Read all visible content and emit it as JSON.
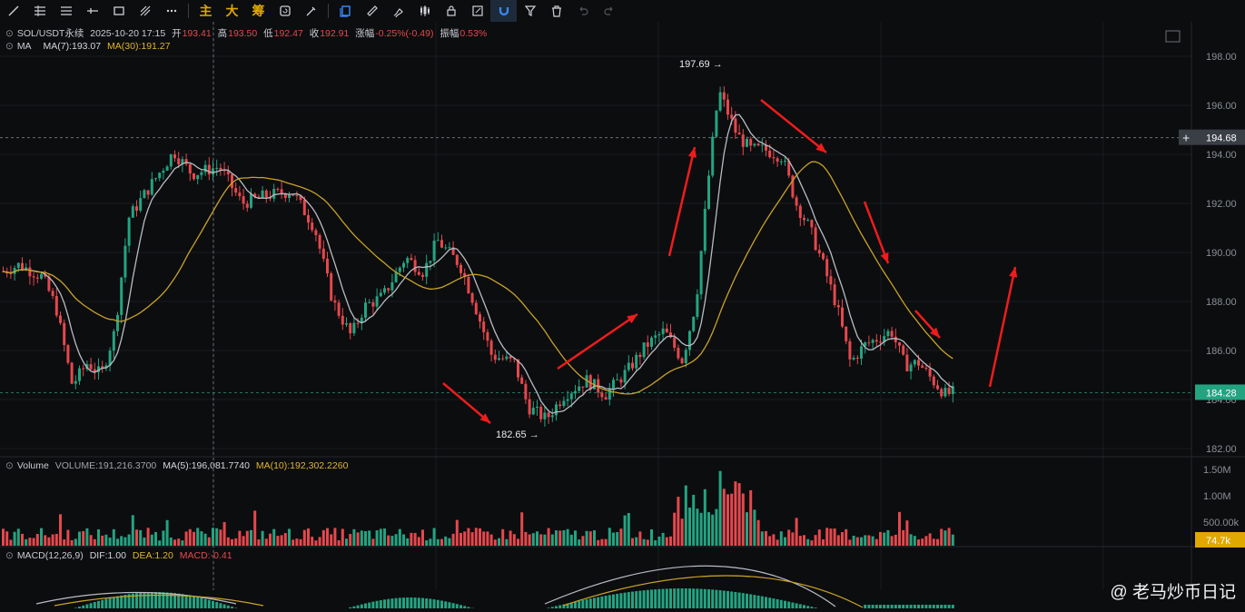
{
  "toolbar": {
    "main_label": "主",
    "big_label": "大",
    "chips_label": "筹"
  },
  "header": {
    "symbol": "SOL/USDT永续",
    "datetime": "2025-10-20 17:15",
    "open_label": "开",
    "open": "193.41",
    "high_label": "高",
    "high": "193.50",
    "low_label": "低",
    "low": "192.47",
    "close_label": "收",
    "close": "192.91",
    "change_label": "涨幅",
    "change": "-0.25%(-0.49)",
    "amplitude_label": "振幅",
    "amplitude": "0.53%"
  },
  "ma_line": {
    "label": "MA",
    "ma7": "MA(7):193.07",
    "ma30": "MA(30):191.27"
  },
  "volume_line": {
    "label": "Volume",
    "vol": "VOLUME:191,216.3700",
    "ma5": "MA(5):196,081.7740",
    "ma10": "MA(10):192,302.2260"
  },
  "macd_line": {
    "label": "MACD(12,26,9)",
    "dif": "DIF:1.00",
    "dea": "DEA:1.20",
    "macd": "MACD:-0.41"
  },
  "price_axis": [
    "198.00",
    "196.00",
    "194.00",
    "192.00",
    "190.00",
    "188.00",
    "186.00",
    "184.00",
    "182.00"
  ],
  "volume_axis": [
    "1.50M",
    "1.00M",
    "500.00k"
  ],
  "badges": {
    "crosshair_price": "194.68",
    "last_price": "184.28",
    "last_volume": "74.7k"
  },
  "annotations": {
    "high": "197.69",
    "low": "182.65"
  },
  "watermark": "@ 老马炒币日记",
  "colors": {
    "up": "#23a481",
    "down": "#e5484d",
    "ma7": "#b9bcc4",
    "ma30": "#c9a227",
    "arrow": "#ee1c1c"
  },
  "chart_data": {
    "type": "candlestick",
    "ylim": [
      181.3,
      198.7
    ],
    "volume_ylim": [
      0,
      1.55
    ],
    "legend_position": "top-left",
    "grid": true
  }
}
